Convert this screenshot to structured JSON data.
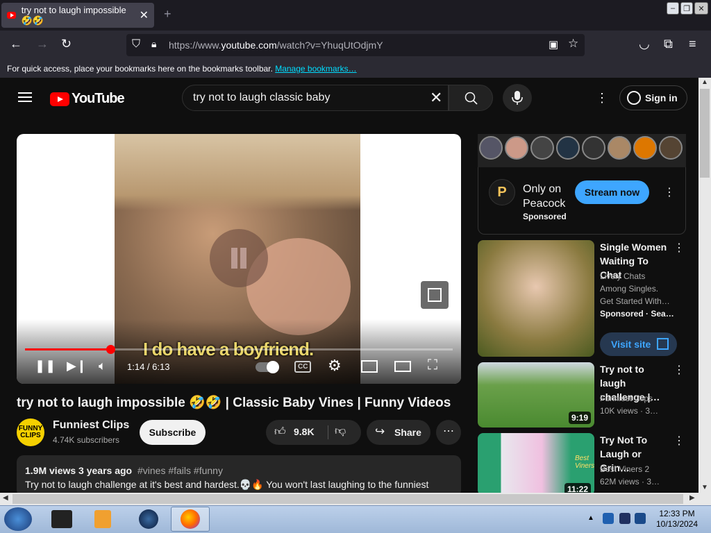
{
  "browser": {
    "tab_title": "try not to laugh impossible 🤣🤣",
    "url_prefix": "https://www.",
    "url_domain": "youtube.com",
    "url_path": "/watch?v=YhuqUtOdjmY",
    "bookmarks_prompt": "For quick access, place your bookmarks here on the bookmarks toolbar.",
    "bookmarks_link": "Manage bookmarks…"
  },
  "header": {
    "logo_text": "YouTube",
    "search_value": "try not to laugh classic baby",
    "sign_in": "Sign in"
  },
  "player": {
    "subtitle": "I do have a boyfriend.",
    "time": "1:14 / 6:13",
    "progress_fraction": 0.199
  },
  "video": {
    "title": "try not to laugh impossible 🤣🤣 | Classic Baby Vines | Funny Videos",
    "channel": "Funniest Clips",
    "channel_logo": "FUNNY CLIPS",
    "subscribers": "4.74K subscribers",
    "subscribe": "Subscribe",
    "likes": "9.8K",
    "share": "Share",
    "stats": "1.9M views  3 years ago",
    "tags": "#vines #fails #funny",
    "description": "Try not to laugh challenge at it's best and hardest.💀🔥 You won't last laughing to the funniest"
  },
  "ad": {
    "logo_letter": "P",
    "title": "Only on Peacock",
    "sponsored": "Sponsored",
    "cta": "Stream now"
  },
  "recommendations": [
    {
      "title": "Single Women Waiting To Chat",
      "line1": "Lively Chats",
      "line2": "Among Singles.",
      "line3": "Get Started With…",
      "meta": "Sponsored · Sea…",
      "cta": "Visit site"
    },
    {
      "title": "Try not to laugh challenge |…",
      "channel": "Funniest Clips",
      "meta": "10K views · 3…",
      "duration": "9:19"
    },
    {
      "title": "Try Not To Laugh or Grin…",
      "channel": "Best Viners 2",
      "meta": "62M views · 3…",
      "duration": "11:22"
    }
  ],
  "taskbar": {
    "time": "12:33 PM",
    "date": "10/13/2024"
  },
  "colors": {
    "yt_red": "#ff0000",
    "accent_blue": "#3ea6ff",
    "bg": "#0f0f0f"
  }
}
